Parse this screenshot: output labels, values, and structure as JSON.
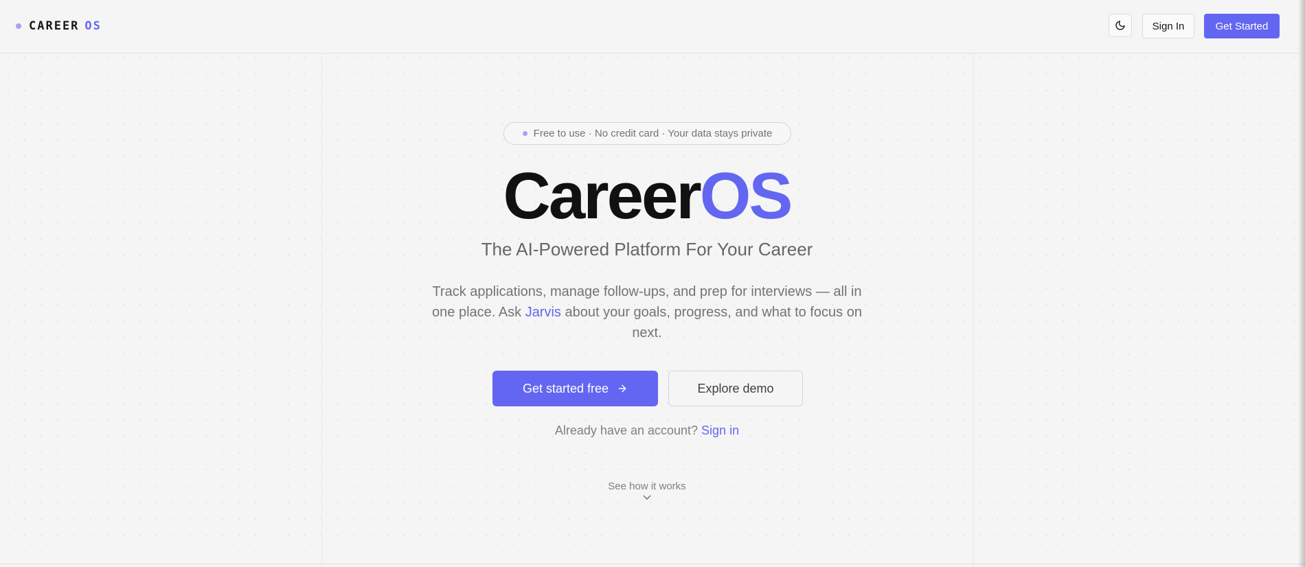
{
  "header": {
    "logo_word": "CAREER",
    "logo_accent": "OS",
    "theme_toggle_icon": "moon-icon",
    "signin_label": "Sign In",
    "get_started_label": "Get Started"
  },
  "hero": {
    "badge_text": "Free to use · No credit card · Your data stays private",
    "title_main": "Career",
    "title_accent": "OS",
    "subtitle": "The AI-Powered Platform For Your Career",
    "description_before": "Track applications, manage follow-ups, and prep for interviews — all in one place. Ask ",
    "description_link": "Jarvis",
    "description_after": " about your goals, progress, and what to focus on next.",
    "cta_primary_label": "Get started free",
    "cta_primary_icon": "arrow-right-icon",
    "cta_secondary_label": "Explore demo",
    "account_prompt": "Already have an account? ",
    "account_link": "Sign in",
    "how_it_works_label": "See how it works",
    "how_it_works_icon": "chevron-down-icon"
  },
  "colors": {
    "accent": "#6366f1",
    "background": "#f5f5f5",
    "text_dark": "#111111",
    "text_muted": "#737373"
  }
}
